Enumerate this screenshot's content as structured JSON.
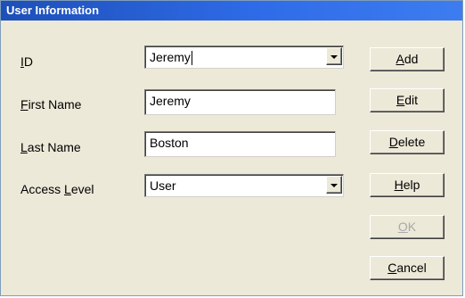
{
  "window": {
    "title": "User Information"
  },
  "fields": {
    "id": {
      "label_mnemonic": "I",
      "label_rest": "D",
      "value": "Jeremy"
    },
    "first_name": {
      "label_mnemonic": "F",
      "label_rest": "irst Name",
      "value": "Jeremy"
    },
    "last_name": {
      "label_mnemonic": "L",
      "label_rest": "ast Name",
      "value": "Boston"
    },
    "access_level": {
      "label_before": "Access ",
      "label_mnemonic": "L",
      "label_rest": "evel",
      "value": "User"
    }
  },
  "buttons": {
    "add": {
      "mnemonic": "A",
      "rest": "dd",
      "enabled": true
    },
    "edit": {
      "mnemonic": "E",
      "rest": "dit",
      "enabled": true
    },
    "delete": {
      "mnemonic": "D",
      "rest": "elete",
      "enabled": true
    },
    "help": {
      "mnemonic": "H",
      "rest": "elp",
      "enabled": true
    },
    "ok": {
      "mnemonic": "O",
      "rest": "K",
      "enabled": false
    },
    "cancel": {
      "mnemonic": "C",
      "rest": "ancel",
      "enabled": true
    }
  },
  "colors": {
    "titlebar": "#2f6be8",
    "dialog_background": "#ece9d8",
    "disabled_text": "#a9a9a9"
  },
  "icons": {
    "dropdown": "chevron-down-icon"
  }
}
